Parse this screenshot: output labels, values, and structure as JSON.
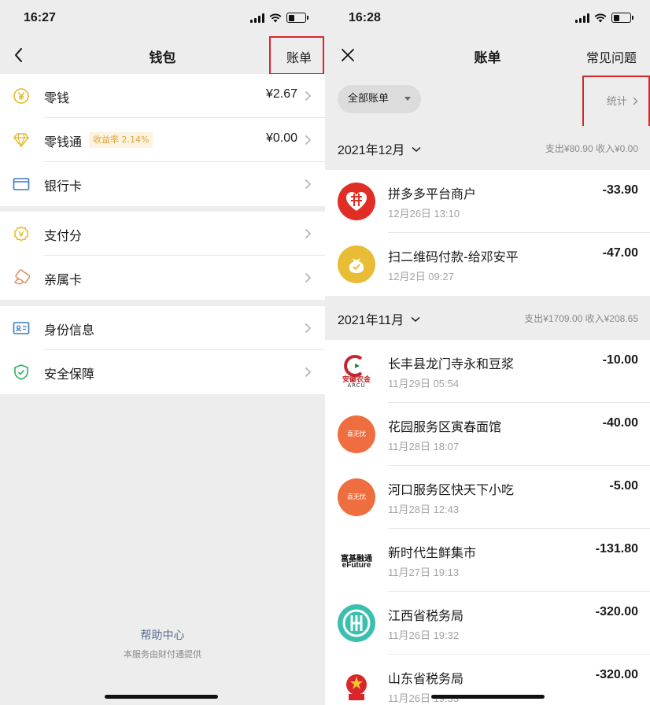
{
  "left": {
    "status": {
      "time": "16:27"
    },
    "nav": {
      "title": "钱包",
      "right": "账单"
    },
    "groups": [
      [
        {
          "icon": "yen-coin-icon",
          "label": "零钱",
          "value": "¥2.67"
        },
        {
          "icon": "diamond-icon",
          "label": "零钱通",
          "badge": "收益率 2.14%",
          "value": "¥0.00"
        },
        {
          "icon": "bank-card-icon",
          "label": "银行卡"
        }
      ],
      [
        {
          "icon": "payscore-icon",
          "label": "支付分"
        },
        {
          "icon": "family-card-icon",
          "label": "亲属卡"
        }
      ],
      [
        {
          "icon": "id-card-icon",
          "label": "身份信息"
        },
        {
          "icon": "shield-icon",
          "label": "安全保障"
        }
      ]
    ],
    "footer": {
      "help": "帮助中心",
      "provided": "本服务由财付通提供"
    }
  },
  "right": {
    "status": {
      "time": "16:28"
    },
    "nav": {
      "title": "账单",
      "right": "常见问题"
    },
    "filter": "全部账单",
    "stats": "统计",
    "months": [
      {
        "label": "2021年12月",
        "summary": "支出¥80.90  收入¥0.00",
        "items": [
          {
            "logo": "pinduoduo-logo",
            "logo_text": "拼",
            "name": "拼多多平台商户",
            "time": "12月26日 13:10",
            "amount": "-33.90"
          },
          {
            "logo": "qr-payment-logo",
            "logo_text": "",
            "name": "扫二维码付款-给邓安平",
            "time": "12月2日 09:27",
            "amount": "-47.00"
          }
        ]
      },
      {
        "label": "2021年11月",
        "summary": "支出¥1709.00  收入¥208.65",
        "items": [
          {
            "logo": "arcu-bank-logo",
            "logo_text": "安徽农金",
            "logo_sub": "ARCU",
            "name": "长丰县龙门寺永和豆浆",
            "time": "11月29日 05:54",
            "amount": "-10.00"
          },
          {
            "logo": "orange-merchant-logo",
            "logo_text": "喜无忧",
            "name": "花园服务区寅春面馆",
            "time": "11月28日 18:07",
            "amount": "-40.00"
          },
          {
            "logo": "orange-merchant-logo",
            "logo_text": "喜无忧",
            "name": "河口服务区快天下小吃",
            "time": "11月28日 12:43",
            "amount": "-5.00"
          },
          {
            "logo": "efuture-logo",
            "logo_text": "富基融通",
            "logo_sub": "eFuture",
            "name": "新时代生鲜集市",
            "time": "11月27日 19:13",
            "amount": "-131.80"
          },
          {
            "logo": "tax-bureau-logo",
            "logo_text": "",
            "name": "江西省税务局",
            "time": "11月26日 19:32",
            "amount": "-320.00"
          },
          {
            "logo": "national-emblem-logo",
            "logo_text": "",
            "name": "山东省税务局",
            "time": "11月26日 19:33",
            "amount": "-320.00"
          }
        ]
      }
    ]
  },
  "colors": {
    "highlight": "#d9262b",
    "badge_bg": "#fcf3e0",
    "badge_text": "#e3a33a",
    "help_link": "#5a6c91"
  }
}
